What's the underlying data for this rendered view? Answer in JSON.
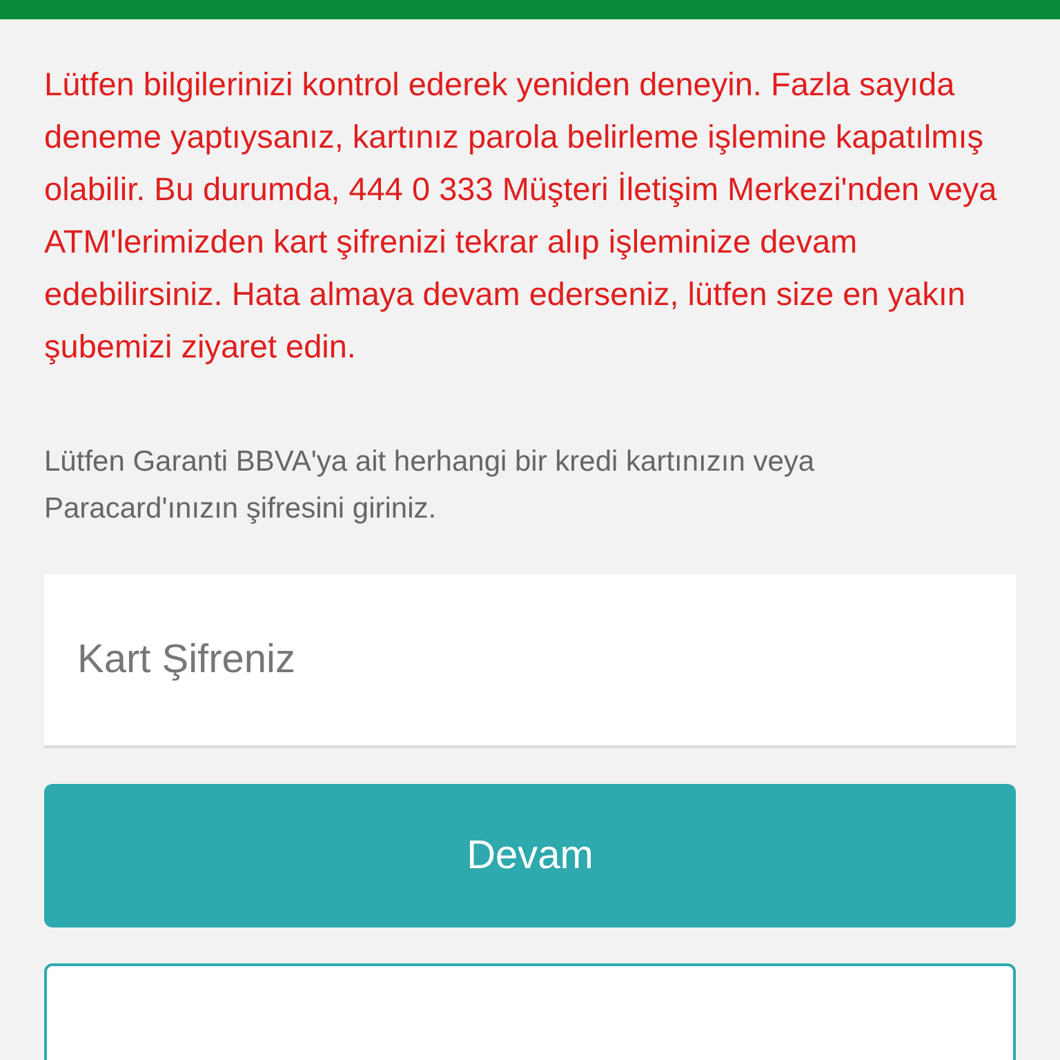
{
  "error_message": "Lütfen bilgilerinizi kontrol ederek yeniden deneyin. Fazla sayıda deneme yaptıysanız, kartınız parola belirleme işlemine kapatılmış olabilir. Bu durumda, 444 0 333 Müşteri İletişim Merkezi'nden veya ATM'lerimizden kart şifrenizi tekrar alıp işleminize devam edebilirsiniz. Hata almaya devam ederseniz, lütfen size en yakın şubemizi ziyaret edin.",
  "instruction": "Lütfen Garanti BBVA'ya ait herhangi bir kredi kartınızın veya Paracard'ınızın şifresini giriniz.",
  "password_field": {
    "placeholder": "Kart Şifreniz"
  },
  "continue_button": {
    "label": "Devam"
  }
}
